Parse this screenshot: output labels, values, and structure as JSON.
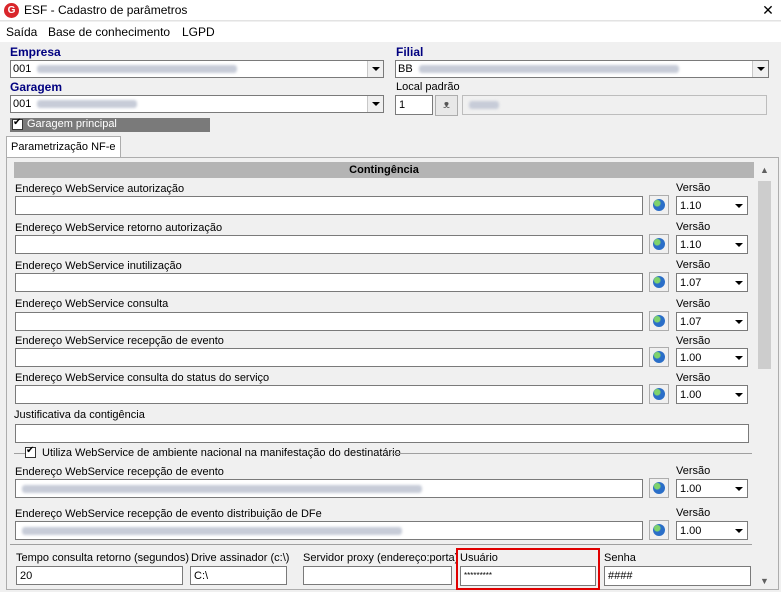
{
  "window": {
    "title": "ESF - Cadastro de parâmetros",
    "close_glyph": "✕",
    "logo_letter": "G"
  },
  "menu": {
    "items": [
      "Saída",
      "Base de conhecimento",
      "LGPD"
    ]
  },
  "empresa": {
    "label": "Empresa",
    "value": "001"
  },
  "filial": {
    "label": "Filial",
    "value": "BB"
  },
  "garagem": {
    "label": "Garagem",
    "value": "001"
  },
  "local_padrao": {
    "label": "Local padrão",
    "value": "1"
  },
  "garagem_principal": {
    "label": "Garagem principal",
    "checked": true
  },
  "tab": {
    "label": "Parametrização NF-e"
  },
  "section": {
    "title": "Contingência"
  },
  "version_label": "Versão",
  "endpoints": [
    {
      "label": "Endereço WebService autorização",
      "version": "1.10"
    },
    {
      "label": "Endereço WebService retorno autorização",
      "version": "1.10"
    },
    {
      "label": "Endereço WebService inutilização",
      "version": "1.07"
    },
    {
      "label": "Endereço WebService consulta",
      "version": "1.07"
    },
    {
      "label": "Endereço WebService recepção de evento",
      "version": "1.00"
    },
    {
      "label": "Endereço WebService consulta do status do serviço",
      "version": "1.00"
    }
  ],
  "justificativa": {
    "label": "Justificativa da contigência"
  },
  "ambiente_nacional": {
    "label": "Utiliza WebService de ambiente nacional na manifestação do destinatário",
    "checked": true
  },
  "national_endpoints": [
    {
      "label": "Endereço WebService recepção de evento",
      "version": "1.00"
    },
    {
      "label": "Endereço WebService recepção de evento distribuição de DFe",
      "version": "1.00"
    }
  ],
  "bottom": {
    "tempo": {
      "label": "Tempo consulta retorno (segundos)",
      "value": "20"
    },
    "drive": {
      "label": "Drive assinador (c:\\)",
      "value": "C:\\"
    },
    "proxy": {
      "label": "Servidor proxy (endereço:porta)",
      "value": ""
    },
    "usuario": {
      "label": "Usuário",
      "value": "*********"
    },
    "senha": {
      "label": "Senha",
      "value": "####"
    }
  },
  "colors": {
    "highlight": "#e00000",
    "section_header": "#b4b4b4",
    "label_blue": "#000080"
  }
}
